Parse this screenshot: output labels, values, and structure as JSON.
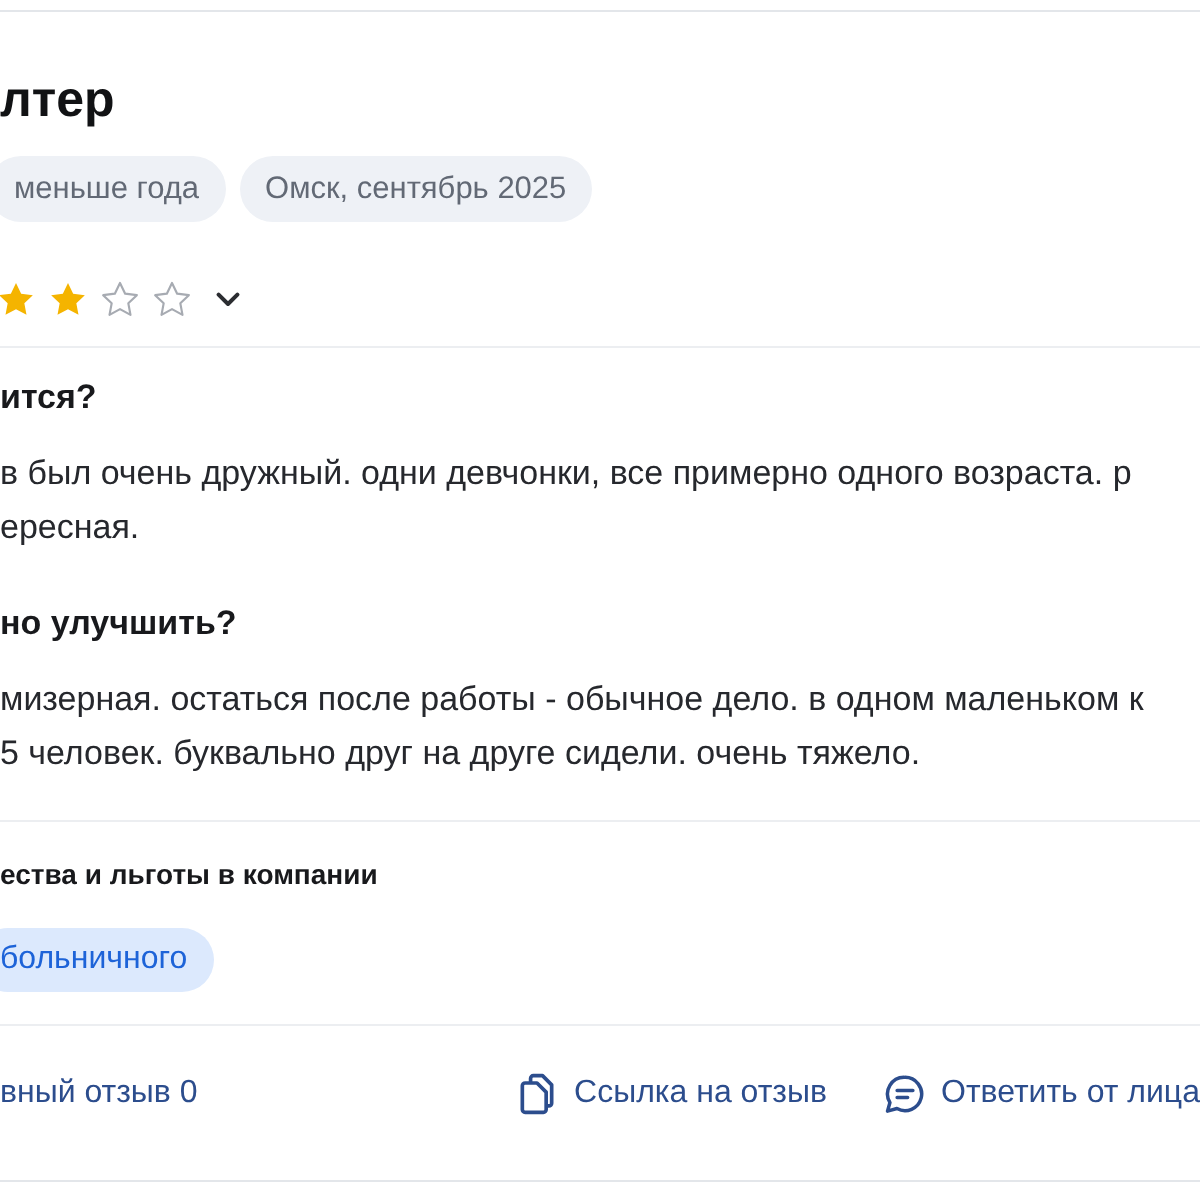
{
  "review": {
    "title": "лтер",
    "tags": [
      "меньше года",
      "Омск, сентябрь 2025"
    ],
    "rating": {
      "stars": 2,
      "expanded": false
    },
    "sections": [
      {
        "heading": "ится?",
        "text": "в был очень дружный. одни девчонки, все примерно одного возраста. р\nересная."
      },
      {
        "heading": "но улучшить?",
        "text": "мизерная. остаться после работы - обычное дело. в одном маленьком к\n5 человек. буквально друг на друге сидели. очень тяжело."
      }
    ],
    "benefits": {
      "heading": "ества и льготы в компании",
      "tags": [
        "больничного"
      ]
    },
    "actions": [
      {
        "kind": "helpful",
        "label": "вный отзыв 0"
      },
      {
        "kind": "link",
        "label": "Ссылка на отзыв"
      },
      {
        "kind": "reply",
        "label": "Ответить от лица"
      }
    ]
  }
}
